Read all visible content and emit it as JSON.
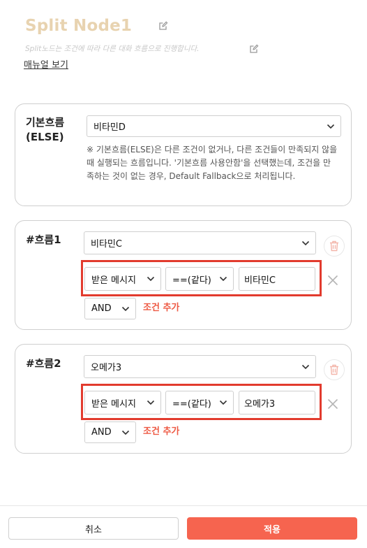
{
  "header": {
    "title": "Split Node1",
    "description": "Split노드는 조건에 따라 다른 대화 흐름으로 진행합니다.",
    "manual_link": "매뉴얼 보기"
  },
  "default_flow": {
    "label_line1": "기본흐름",
    "label_line2": "(ELSE)",
    "selected": "비타민D",
    "note": "※ 기본흐름(ELSE)은 다른 조건이 없거나, 다른 조건들이 만족되지 않을때 실행되는 흐름입니다. '기본흐름 사용안함'을 선택했는데, 조건을 만족하는 것이 없는 경우, Default Fallback으로 처리됩니다."
  },
  "flows": [
    {
      "label": "#흐름1",
      "target": "비타민C",
      "condition": {
        "field": "받은 메시지",
        "operator": "==(같다)",
        "value": "비타민C"
      },
      "logic": "AND",
      "add_condition": "조건 추가"
    },
    {
      "label": "#흐름2",
      "target": "오메가3",
      "condition": {
        "field": "받은 메시지",
        "operator": "==(같다)",
        "value": "오메가3"
      },
      "logic": "AND",
      "add_condition": "조건 추가"
    }
  ],
  "footer": {
    "cancel": "취소",
    "apply": "적용"
  },
  "icons": {
    "edit": "pencil-square-icon",
    "dropdown": "chevron-down-icon",
    "delete": "trash-icon",
    "remove": "close-x-icon"
  },
  "colors": {
    "title": "#e8d3b0",
    "accent": "#f6644f",
    "highlight_box": "#e23b2e",
    "add_condition": "#ee5a44"
  }
}
